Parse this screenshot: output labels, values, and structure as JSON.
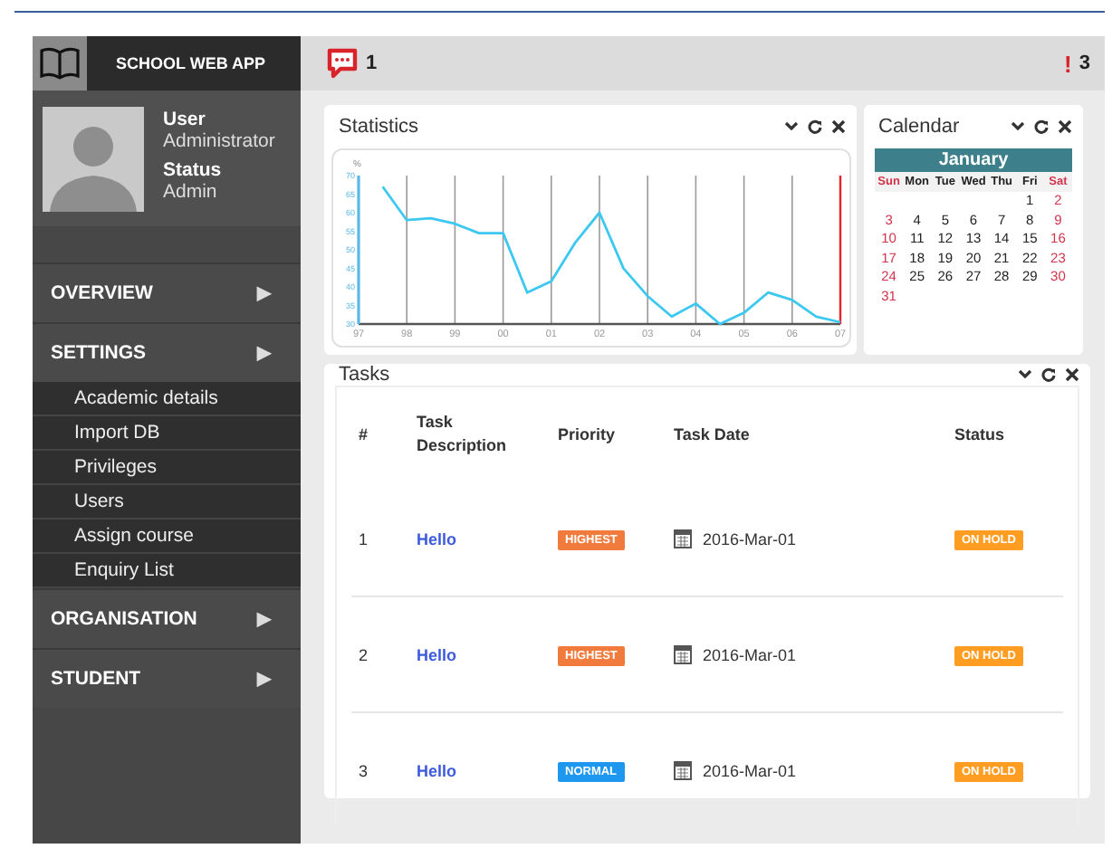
{
  "app": {
    "title": "SCHOOL WEB APP"
  },
  "topbar": {
    "messages": "1",
    "alerts_icon": "!",
    "alerts": "3"
  },
  "profile": {
    "user_label": "User",
    "user_value": "Administrator",
    "status_label": "Status",
    "status_value": "Admin"
  },
  "nav": [
    {
      "label": "OVERVIEW",
      "arrow": "▶"
    },
    {
      "label": "SETTINGS",
      "arrow": "▶",
      "children": [
        {
          "label": "Academic details"
        },
        {
          "label": "Import DB"
        },
        {
          "label": "Privileges"
        },
        {
          "label": "Users"
        },
        {
          "label": "Assign course"
        },
        {
          "label": "Enquiry List"
        }
      ]
    },
    {
      "label": "ORGANISATION",
      "arrow": "▶"
    },
    {
      "label": "STUDENT",
      "arrow": "▶"
    }
  ],
  "statistics": {
    "title": "Statistics",
    "chart_data": {
      "type": "line",
      "ylabel": "%",
      "categories": [
        "97",
        null,
        "98",
        null,
        "99",
        null,
        "00",
        null,
        "01",
        null,
        "02",
        null,
        "03",
        null,
        "04",
        null,
        "05",
        null,
        "06",
        null,
        "07"
      ],
      "series": [
        {
          "color": "#3cc8f0",
          "values": [
            null,
            67,
            58,
            58.5,
            57,
            54.5,
            54.5,
            38.5,
            41.5,
            52,
            60,
            45,
            37.5,
            32,
            35.5,
            30,
            33,
            38.5,
            36.5,
            32,
            30.5
          ]
        }
      ],
      "ylim": [
        30,
        70
      ],
      "grid": true,
      "yticks": [
        30,
        35,
        40,
        45,
        50,
        55,
        60,
        65,
        70
      ]
    }
  },
  "calendar": {
    "title": "Calendar",
    "month": "January",
    "weekdays": [
      "Sun",
      "Mon",
      "Tue",
      "Wed",
      "Thu",
      "Fri",
      "Sat"
    ],
    "weeks": [
      {
        "kind": "leading",
        "days": [
          "1",
          "2"
        ]
      },
      {
        "kind": "full",
        "days": [
          "3",
          "4",
          "5",
          "6",
          "7",
          "8",
          "9"
        ]
      },
      {
        "kind": "full",
        "days": [
          "10",
          "11",
          "12",
          "13",
          "14",
          "15",
          "16"
        ]
      },
      {
        "kind": "full",
        "days": [
          "17",
          "18",
          "19",
          "20",
          "21",
          "22",
          "23"
        ]
      },
      {
        "kind": "full",
        "days": [
          "24",
          "25",
          "26",
          "27",
          "28",
          "29",
          "30"
        ]
      },
      {
        "kind": "trailing",
        "days": [
          "31"
        ]
      }
    ]
  },
  "tasks": {
    "title": "Tasks",
    "columns": [
      "#",
      "Task Description",
      "Priority",
      "Task Date",
      "Status"
    ],
    "rows": [
      {
        "num": "1",
        "description": "Hello",
        "priority": "HIGHEST",
        "kind": "highest",
        "date": "2016-Mar-01",
        "status": "ON HOLD"
      },
      {
        "num": "2",
        "description": "Hello",
        "priority": "HIGHEST",
        "kind": "highest",
        "date": "2016-Mar-01",
        "status": "ON HOLD"
      },
      {
        "num": "3",
        "description": "Hello",
        "priority": "NORMAL",
        "kind": "normal",
        "date": "2016-Mar-01",
        "status": "ON HOLD"
      }
    ]
  }
}
